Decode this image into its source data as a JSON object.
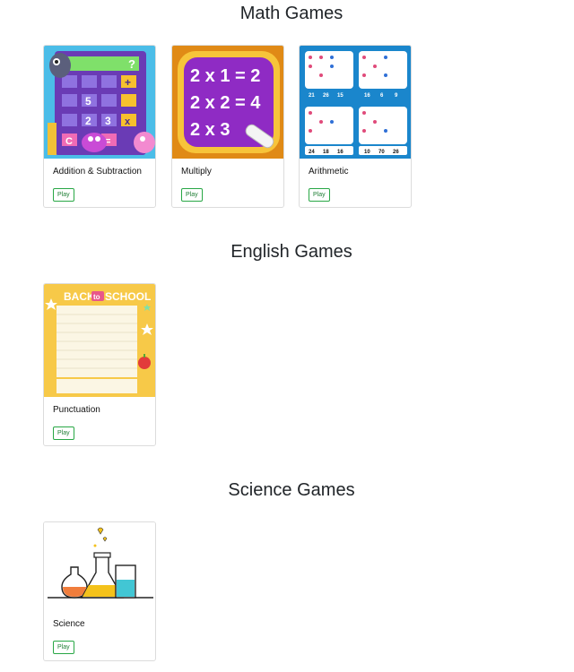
{
  "sections": [
    {
      "title": "Math Games",
      "games": [
        {
          "title": "Addition & Subtraction",
          "play_label": "Play",
          "thumbnail": "calculator-monsters-image"
        },
        {
          "title": "Multiply",
          "play_label": "Play",
          "thumbnail": "multiplication-chalkboard-image",
          "thumb_text": [
            "2 x 1 = 2",
            "2 x 2 = 4",
            "2 x 3"
          ]
        },
        {
          "title": "Arithmetic",
          "play_label": "Play",
          "thumbnail": "arithmetic-puzzle-image",
          "thumb_text": [
            "21",
            "26",
            "15",
            "16",
            "6",
            "9",
            "24",
            "18",
            "16",
            "10",
            "70",
            "26"
          ]
        }
      ]
    },
    {
      "title": "English Games",
      "games": [
        {
          "title": "Punctuation",
          "play_label": "Play",
          "thumbnail": "back-to-school-wordsearch-image",
          "thumb_text": [
            "BACK",
            "to",
            "SCHOOL"
          ]
        }
      ]
    },
    {
      "title": "Science Games",
      "games": [
        {
          "title": "Science",
          "play_label": "Play",
          "thumbnail": "lab-flasks-image"
        }
      ]
    }
  ],
  "colors": {
    "play_border": "#28a745",
    "play_text": "#1e7e34",
    "card_border": "#dcdcdc"
  }
}
